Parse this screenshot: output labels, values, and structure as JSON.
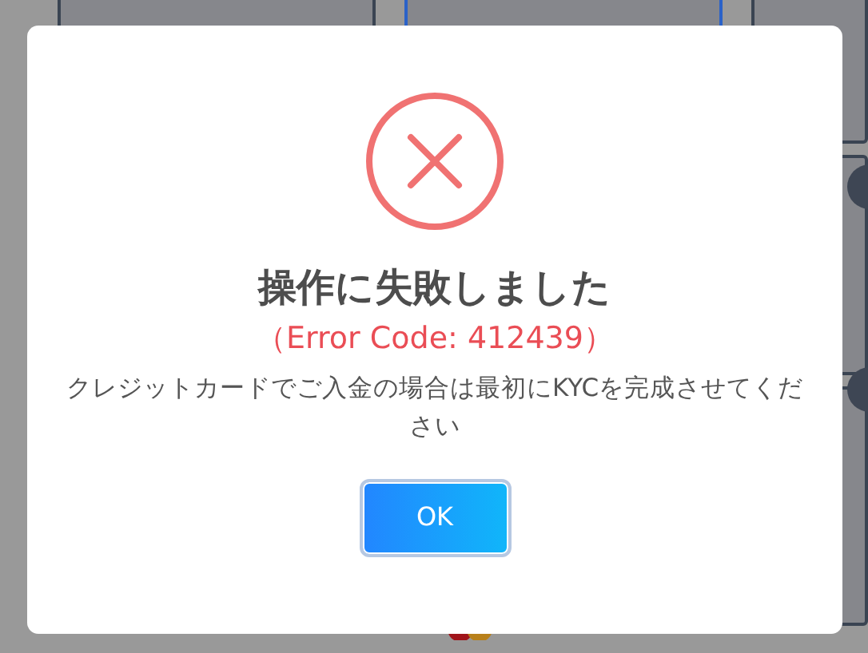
{
  "dialog": {
    "kind": "error",
    "title": "操作に失敗しました",
    "error_code": "（Error Code: 412439）",
    "message": "クレジットカードでご入金の場合は最初にKYCを完成させてください",
    "buttons": [
      {
        "label": "OK"
      }
    ]
  }
}
